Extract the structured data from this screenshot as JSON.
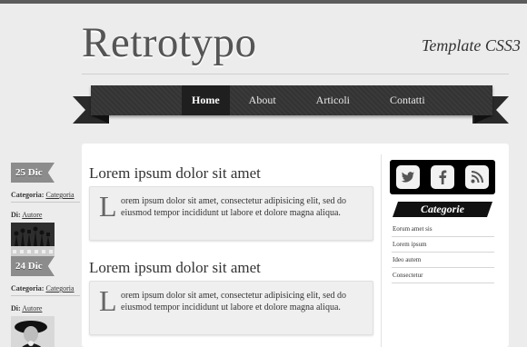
{
  "site": {
    "title": "Retrotypo",
    "tagline": "Template CSS3"
  },
  "nav": {
    "items": [
      {
        "label": "Home",
        "active": true
      },
      {
        "label": "About",
        "active": false
      },
      {
        "label": "Articoli",
        "active": false
      },
      {
        "label": "Contatti",
        "active": false
      }
    ]
  },
  "meta_labels": {
    "category": "Categoria:",
    "author": "Di:"
  },
  "posts": [
    {
      "date": "25 Dic",
      "category": "Categoria",
      "author": "Autore",
      "title": "Lorem ipsum dolor sit amet",
      "dropcap": "L",
      "body": "orem ipsum dolor sit amet, consectetur adipisicing elit, sed do eiusmod tempor incididunt ut labore et dolore magna aliqua."
    },
    {
      "date": "24 Dic",
      "category": "Categoria",
      "author": "Autore",
      "title": "Lorem ipsum dolor sit amet",
      "dropcap": "L",
      "body": "orem ipsum dolor sit amet, consectetur adipisicing elit, sed do eiusmod tempor incididunt ut labore et dolore magna aliqua."
    }
  ],
  "sidebar": {
    "social": [
      "twitter-icon",
      "facebook-icon",
      "rss-icon"
    ],
    "categories_title": "Categorie",
    "categories": [
      "Eorum amet sis",
      "Lorem ipsum",
      "Ideo autem",
      "Consectetur"
    ]
  },
  "colors": {
    "background": "#ececec",
    "ribbon": "#333333",
    "date_tab": "#8c8c8c",
    "accent_dark": "#111111"
  }
}
